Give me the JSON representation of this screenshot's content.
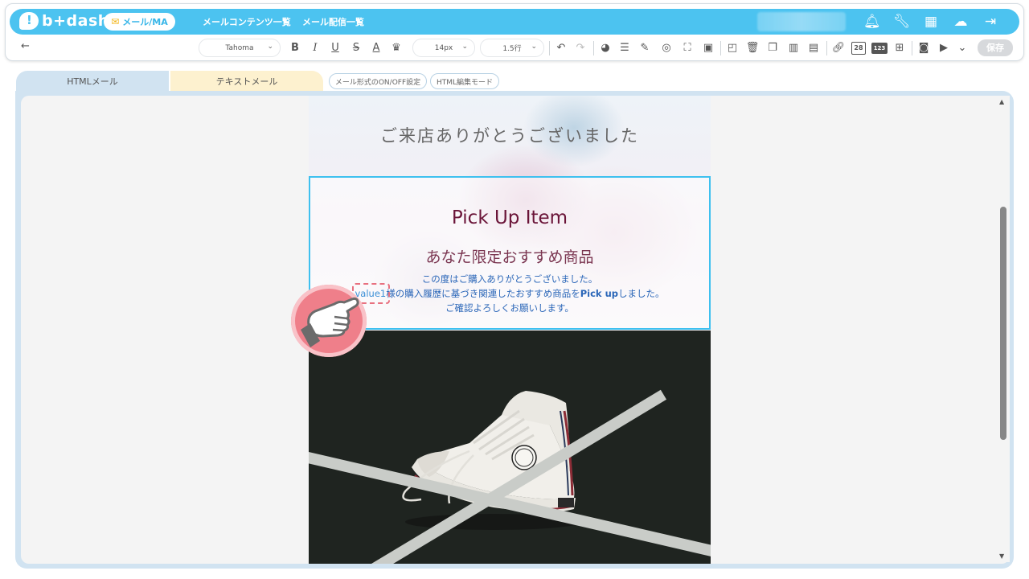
{
  "app": {
    "logo_text": "b+dash",
    "nav_pill": "メール/MA",
    "nav_links": [
      "メールコンテンツ一覧",
      "メール配信一覧"
    ],
    "top_icons": [
      "bell-icon",
      "wrench-icon",
      "grid-icon",
      "chat-icon",
      "logout-icon"
    ]
  },
  "toolbar": {
    "font_family": "Tahoma",
    "font_size": "14px",
    "line_height": "1.5行",
    "save_label": "保存",
    "calendar_day": "28",
    "number_label": "123"
  },
  "tabs": {
    "html_mail": "HTMLメール",
    "text_mail": "テキストメール",
    "format_toggle": "メール形式のON/OFF設定",
    "html_edit_mode": "HTML編集モード"
  },
  "email": {
    "thanks_heading": "ご来店ありがとうございました",
    "pick_title": "Pick Up Item",
    "pick_subtitle": "あなた限定おすすめ商品",
    "body_line1": "この度はご購入ありがとうございました。",
    "value_tag": "value1",
    "body_line2_a": "様の購入履歴に基づき関連したおすすめ商品を",
    "body_line2_bold": "Pick up",
    "body_line2_b": "しました。",
    "body_line3": "ご確認よろしくお願いします。"
  },
  "colors": {
    "brand": "#4cc3f0",
    "selection_border": "#3ec0ef",
    "title_color": "#6a1438",
    "body_text": "#2a66b8",
    "pointer_badge": "#ef7f8a"
  }
}
